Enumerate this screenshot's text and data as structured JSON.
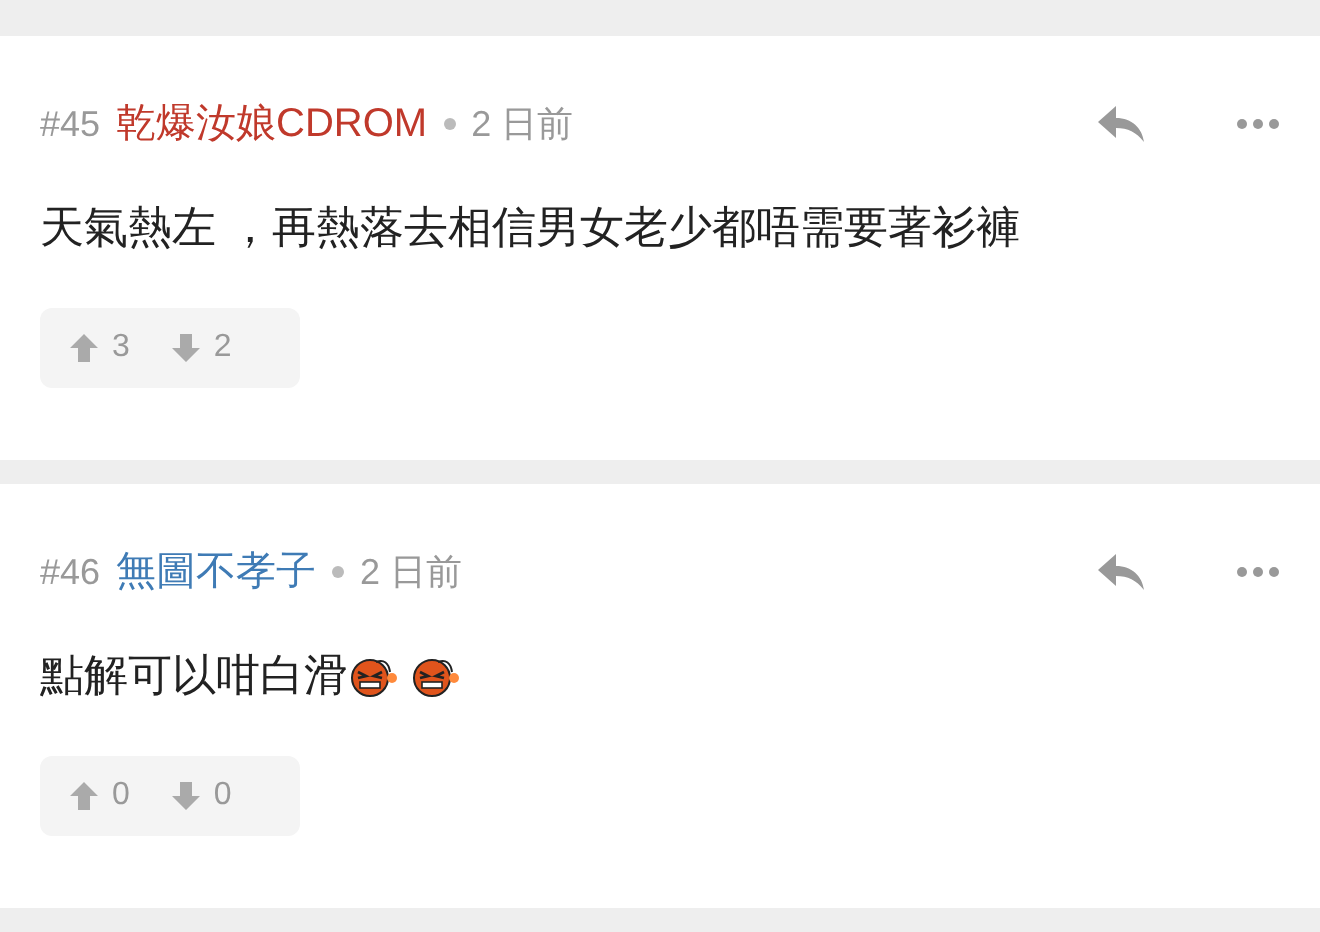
{
  "comments": [
    {
      "number": "#45",
      "user": "乾爆汝娘CDROM",
      "color": "#c0392b",
      "time": "2 日前",
      "body": [
        {
          "kind": "text",
          "text": "天氣熱左 ，再熱落去相信男女老少都唔需要著衫褲"
        }
      ],
      "upvotes": "3",
      "downvotes": "2"
    },
    {
      "number": "#46",
      "user": "無圖不孝子",
      "color": "#3f7bb5",
      "time": "2 日前",
      "body": [
        {
          "kind": "text",
          "text": "點解可以咁白滑"
        },
        {
          "kind": "emoji"
        },
        {
          "kind": "emoji"
        }
      ],
      "upvotes": "0",
      "downvotes": "0"
    }
  ]
}
